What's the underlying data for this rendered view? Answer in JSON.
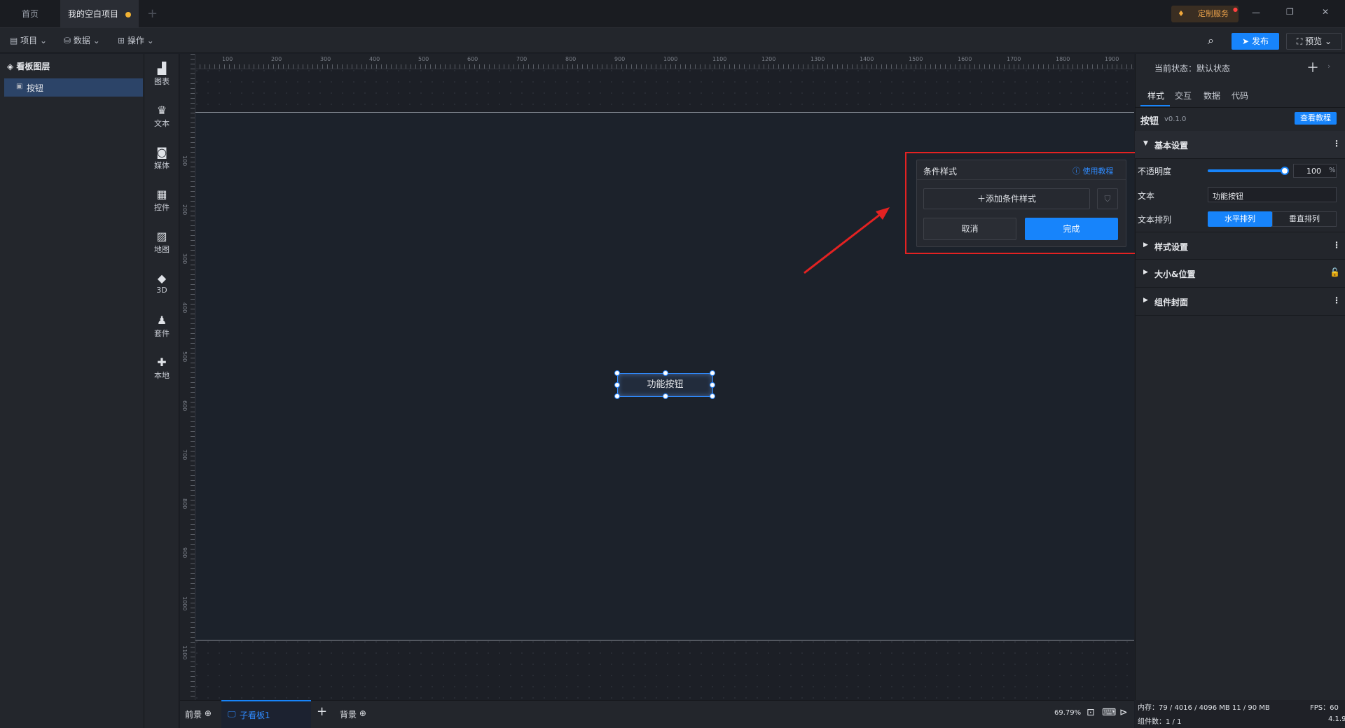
{
  "titlebar": {
    "tabs": [
      {
        "label": "首页"
      },
      {
        "label": "我的空白项目"
      }
    ],
    "add_tab": "+",
    "custom_service": "定制服务",
    "window_controls": {
      "minimize": "—",
      "restore": "❐",
      "close": "✕"
    }
  },
  "toolbar": {
    "menus": [
      {
        "label": "项目"
      },
      {
        "label": "数据"
      },
      {
        "label": "操作"
      }
    ],
    "publish": "发布",
    "preview": "预览"
  },
  "layers": {
    "title": "看板图层",
    "items": [
      {
        "label": "按钮"
      }
    ]
  },
  "leftbar": {
    "items": [
      {
        "label": "图表",
        "icon": "chart-icon"
      },
      {
        "label": "文本",
        "icon": "text-icon"
      },
      {
        "label": "媒体",
        "icon": "media-icon"
      },
      {
        "label": "控件",
        "icon": "widget-icon"
      },
      {
        "label": "地图",
        "icon": "map-icon"
      },
      {
        "label": "3D",
        "icon": "cube-icon"
      },
      {
        "label": "套件",
        "icon": "suite-icon"
      },
      {
        "label": "本地",
        "icon": "puzzle-icon"
      }
    ]
  },
  "ruler": {
    "h_labels": [
      "100",
      "200",
      "300",
      "400",
      "500",
      "600",
      "700",
      "800",
      "900",
      "1000",
      "1100",
      "1200",
      "1300",
      "1400",
      "1500",
      "1600",
      "1700",
      "1800",
      "1900"
    ],
    "v_labels": [
      "100",
      "200",
      "300",
      "400",
      "500",
      "600",
      "700",
      "800",
      "900",
      "1000",
      "1100"
    ]
  },
  "canvas": {
    "button_label": "功能按钮"
  },
  "popup": {
    "title": "条件样式",
    "help": "使用教程",
    "add_condition": "添加条件样式",
    "cancel": "取消",
    "done": "完成"
  },
  "bottombar": {
    "front": "前景",
    "sub_board": "子看板1",
    "background": "背景",
    "add": "+",
    "zoom": "69.79%"
  },
  "rightpanel": {
    "state_label": "当前状态：默认状态",
    "tabs": [
      {
        "label": "样式"
      },
      {
        "label": "交互"
      },
      {
        "label": "数据"
      },
      {
        "label": "代码"
      }
    ],
    "component_name": "按钮",
    "version": "v0.1.0",
    "tutorial": "查看教程",
    "sections": {
      "basic": "基本设置",
      "style": "样式设置",
      "size_pos": "大小&位置",
      "cover": "组件封面"
    },
    "opacity_label": "不透明度",
    "opacity_value": "100",
    "opacity_unit": "%",
    "opacity": 1.0,
    "text_label": "文本",
    "text_value": "功能按钮",
    "arrange_label": "文本排列",
    "arrange_options": [
      {
        "label": "水平排列"
      },
      {
        "label": "垂直排列"
      }
    ]
  },
  "status": {
    "memory": "内存：79 / 4016 / 4096 MB  11 / 90 MB",
    "fps": "FPS：60",
    "components": "组件数：1 / 1",
    "version": "4.1.9"
  },
  "colors": {
    "accent": "#1784fb",
    "highlight": "#e32222",
    "tab_dot": "#f2b233"
  }
}
